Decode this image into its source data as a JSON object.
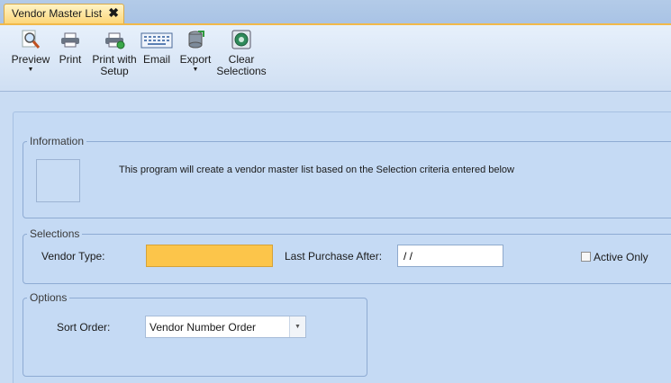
{
  "tab": {
    "title": "Vendor Master List",
    "close_glyph": "✖"
  },
  "toolbar": {
    "preview": "Preview",
    "print": "Print",
    "print_with_setup_1": "Print with",
    "print_with_setup_2": "Setup",
    "email": "Email",
    "export": "Export",
    "clear_1": "Clear",
    "clear_2": "Selections",
    "caret": "▼"
  },
  "information": {
    "legend": "Information",
    "text": "This program will create a vendor master list based on the Selection criteria entered below"
  },
  "selections": {
    "legend": "Selections",
    "vendor_type_label": "Vendor Type:",
    "vendor_type_value": "",
    "last_purchase_label": "Last Purchase After:",
    "last_purchase_value": "/ /",
    "active_only_label": "Active Only",
    "active_only_checked": false
  },
  "options": {
    "legend": "Options",
    "sort_order_label": "Sort Order:",
    "sort_order_value": "Vendor Number Order",
    "arrow": "▼"
  },
  "colors": {
    "active_field": "#fcc54a",
    "tab_accent": "#f1b94a"
  }
}
